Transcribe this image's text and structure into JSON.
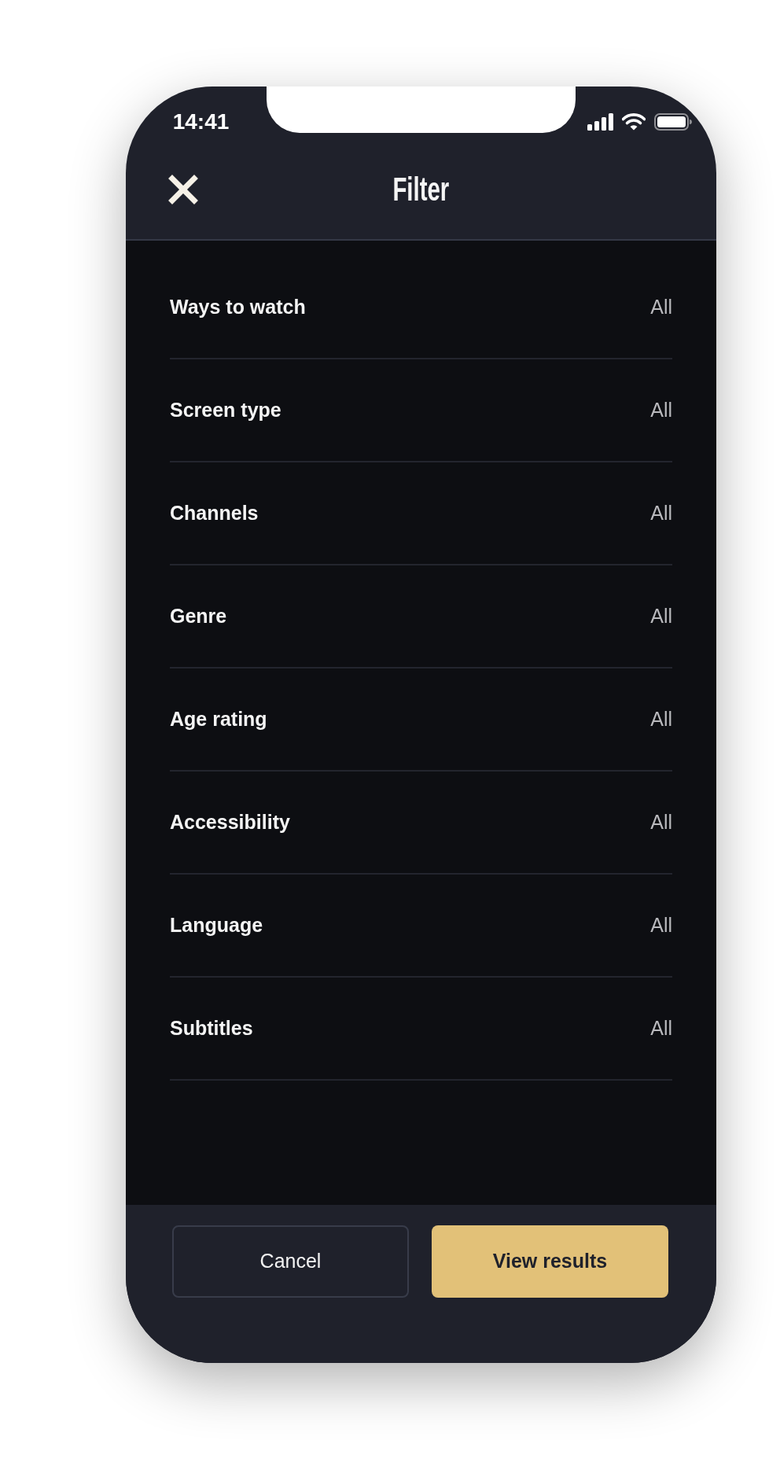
{
  "status_bar": {
    "time": "14:41"
  },
  "header": {
    "title": "Filter"
  },
  "filters": [
    {
      "label": "Ways to watch",
      "value": "All"
    },
    {
      "label": "Screen type",
      "value": "All"
    },
    {
      "label": "Channels",
      "value": "All"
    },
    {
      "label": "Genre",
      "value": "All"
    },
    {
      "label": "Age rating",
      "value": "All"
    },
    {
      "label": "Accessibility",
      "value": "All"
    },
    {
      "label": "Language",
      "value": "All"
    },
    {
      "label": "Subtitles",
      "value": "All"
    }
  ],
  "buttons": [
    {
      "label": "Cancel",
      "kind": "secondary"
    },
    {
      "label": "View results",
      "kind": "primary"
    }
  ]
}
